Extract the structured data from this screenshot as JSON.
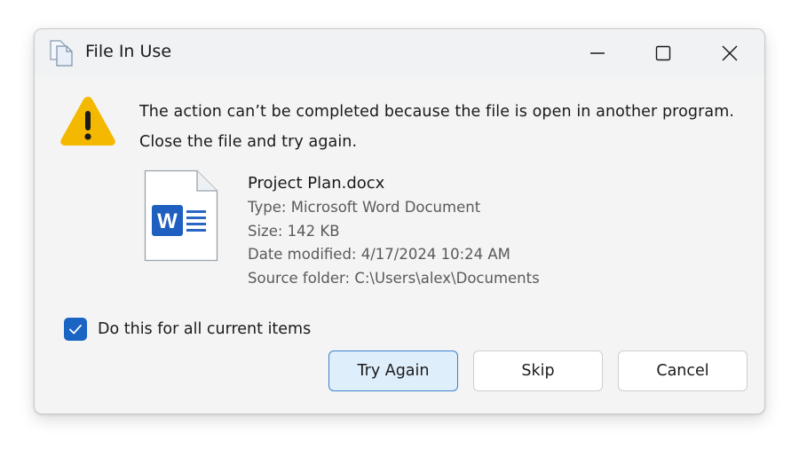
{
  "window": {
    "title": "File In Use",
    "controls": [
      "minimize",
      "maximize",
      "close"
    ]
  },
  "message": {
    "line1": "The action can’t be completed because the file is open in another program.",
    "line2": "Close the file and try again."
  },
  "file": {
    "name": "Project Plan.docx",
    "type": "Type: Microsoft Word Document",
    "size": "Size: 142 KB",
    "date_modified": "Date modified: 4/17/2024 10:24 AM",
    "source_folder": "Source folder: C:\\Users\\alex\\Documents",
    "icon": "word-document-icon",
    "icon_letter": "W"
  },
  "checkbox": {
    "label": "Do this for all current items",
    "checked": true
  },
  "buttons": {
    "try_again": "Try Again",
    "skip": "Skip",
    "cancel": "Cancel"
  },
  "colors": {
    "accent": "#1a64c4",
    "warning": "#f5b800",
    "word_blue": "#1e5fbf",
    "primary_button_bg": "#dfeefb",
    "primary_button_border": "#3c82cf"
  }
}
